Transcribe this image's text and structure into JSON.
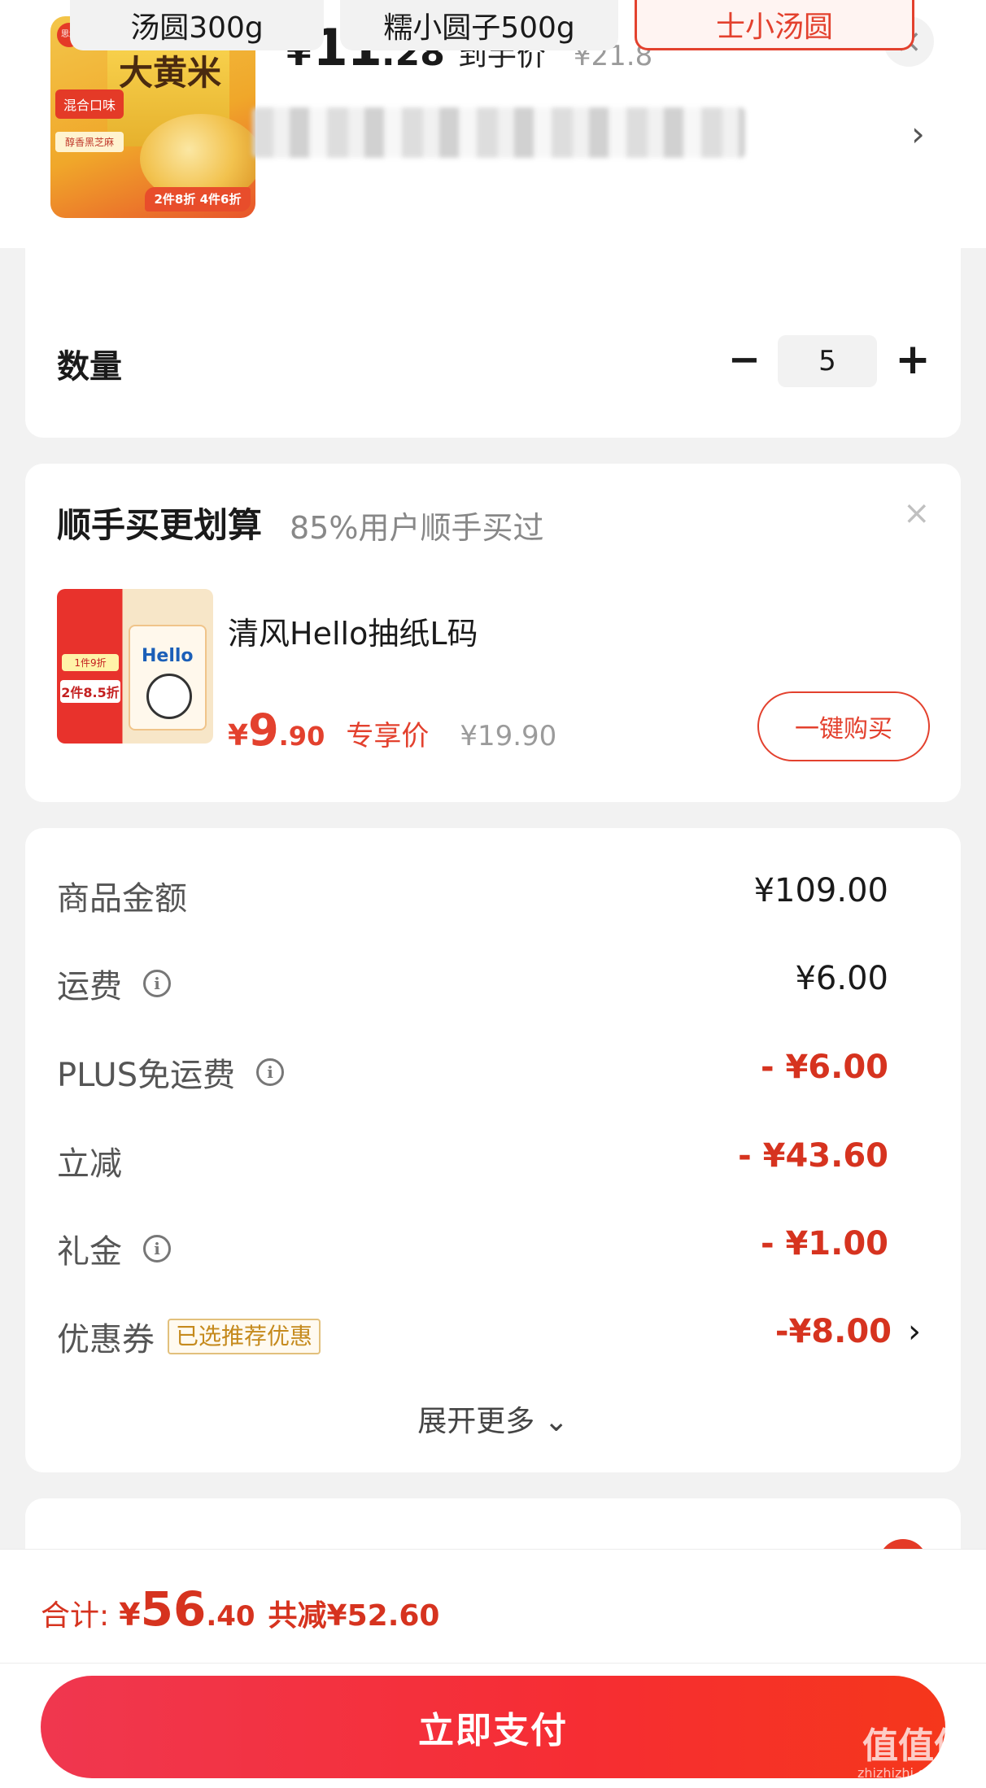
{
  "header": {
    "price_yen": "¥",
    "price_int": "11",
    "price_dec": ".28",
    "price_tag": "到手价",
    "original_price": "¥21.8",
    "product_image": {
      "brand": "思念",
      "title": "大黄米",
      "side_label": "混合口味",
      "side_label2": "醇香黑芝麻",
      "promo": "2件8折 4件6折"
    }
  },
  "specs": {
    "items": [
      "汤圆300g",
      "糯小圆子500g",
      "士小汤圆"
    ],
    "selected_index": 2
  },
  "quantity": {
    "label": "数量",
    "minus": "−",
    "value": "5",
    "plus": "+"
  },
  "addon": {
    "title": "顺手买更划算",
    "subtitle": "85%用户顺手买过",
    "product_name": "清风Hello抽纸L码",
    "price_yen": "¥",
    "price_int": "9",
    "price_dec": ".90",
    "price_label": "专享价",
    "original_price": "¥19.90",
    "buy_button": "一键购买",
    "image": {
      "tag1": "1件9折",
      "tag2": "2件8.5折",
      "pack_text": "Hello"
    }
  },
  "fees": {
    "items": [
      {
        "label": "商品金额",
        "value": "¥109.00",
        "info": false,
        "discount": false
      },
      {
        "label": "运费",
        "value": "¥6.00",
        "info": true,
        "discount": false
      },
      {
        "label": "PLUS免运费",
        "value": "- ¥6.00",
        "info": true,
        "discount": true
      },
      {
        "label": "立减",
        "value": "- ¥43.60",
        "info": false,
        "discount": true
      },
      {
        "label": "礼金",
        "value": "- ¥1.00",
        "info": true,
        "discount": true
      },
      {
        "label": "优惠券",
        "value": "-¥8.00",
        "info": false,
        "discount": true
      }
    ],
    "coupon_tag": "已选推荐优惠",
    "expand_label": "展开更多 ⌄"
  },
  "footer": {
    "total_label": "合计:",
    "total_yen": "¥",
    "total_int": "56",
    "total_dec": ".40",
    "saved": "共减¥52.60",
    "pay_button": "立即支付"
  },
  "watermark": {
    "text": "值值值",
    "sub": "zhizhizhi.com"
  },
  "colors": {
    "accent": "#e3412e",
    "discount": "#d6331f",
    "pay_gradient_start": "#f0374f",
    "pay_gradient_end": "#f5371b"
  },
  "icons": [
    "close-icon",
    "chevron-right-icon",
    "info-icon",
    "minus-icon",
    "plus-icon",
    "chevron-down-icon"
  ]
}
